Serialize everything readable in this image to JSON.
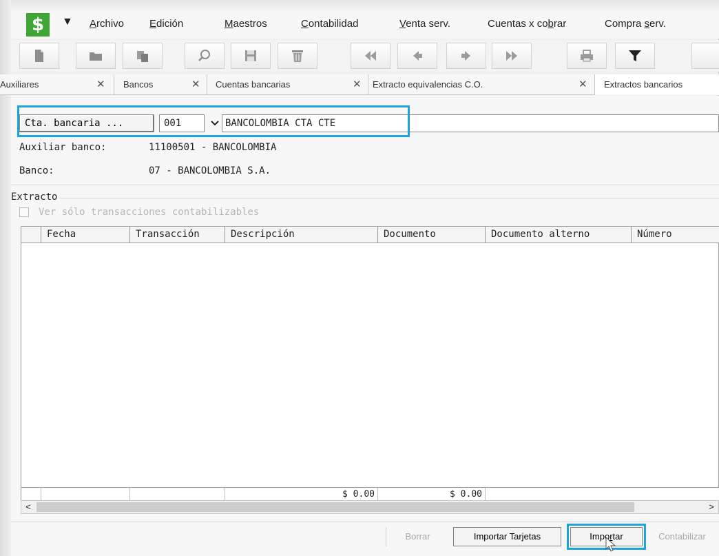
{
  "app": {
    "logo_symbol": "$",
    "logo_color": "#3fa535",
    "menu_arrow": "▼"
  },
  "menu": [
    {
      "pre": "",
      "ul": "A",
      "post": "rchivo"
    },
    {
      "pre": "",
      "ul": "E",
      "post": "dición"
    },
    {
      "pre": "",
      "ul": "M",
      "post": "aestros"
    },
    {
      "pre": "",
      "ul": "C",
      "post": "ontabilidad"
    },
    {
      "pre": "",
      "ul": "V",
      "post": "enta serv."
    },
    {
      "pre": "Cuentas x co",
      "ul": "b",
      "post": "rar"
    },
    {
      "pre": "Compra ",
      "ul": "s",
      "post": "erv."
    }
  ],
  "toolbar": {
    "icons": [
      "new-document-icon",
      "open-folder-icon",
      "copy-icon",
      "search-icon",
      "save-icon",
      "delete-icon",
      "first-record-icon",
      "previous-record-icon",
      "next-record-icon",
      "last-record-icon",
      "print-icon",
      "filter-icon"
    ]
  },
  "tabs": [
    {
      "label": "Auxiliares",
      "close": "✕"
    },
    {
      "label": "Bancos",
      "close": "✕"
    },
    {
      "label": "Cuentas bancarias",
      "close": "✕"
    },
    {
      "label": "Extracto equivalencias C.O.",
      "close": "✕"
    },
    {
      "label": "Extractos bancarios",
      "close": ""
    }
  ],
  "form": {
    "cta_button": "Cta. bancaria ...",
    "code_value": "001",
    "name_value": "BANCOLOMBIA CTA CTE",
    "aux_label": "Auxiliar banco:",
    "aux_value": "11100501 - BANCOLOMBIA",
    "bank_label": "Banco:",
    "bank_value": "07 - BANCOLOMBIA S.A."
  },
  "extracto": {
    "legend": "Extracto",
    "checkbox_label": "Ver sólo transacciones contabilizables",
    "columns": [
      "",
      "Fecha",
      "Transacción",
      "Descripción",
      "Documento",
      "Documento alterno",
      "Número"
    ],
    "totals": [
      "$ 0.00",
      "$ 0.00"
    ]
  },
  "buttons": {
    "borrar": "Borrar",
    "importar_tarjetas": "Importar Tarjetas",
    "importar_pre": "Impo",
    "importar_ul": "r",
    "importar_post": "tar",
    "contabilizar": "Contabilizar"
  },
  "colors": {
    "highlight": "#1aa3dd"
  }
}
